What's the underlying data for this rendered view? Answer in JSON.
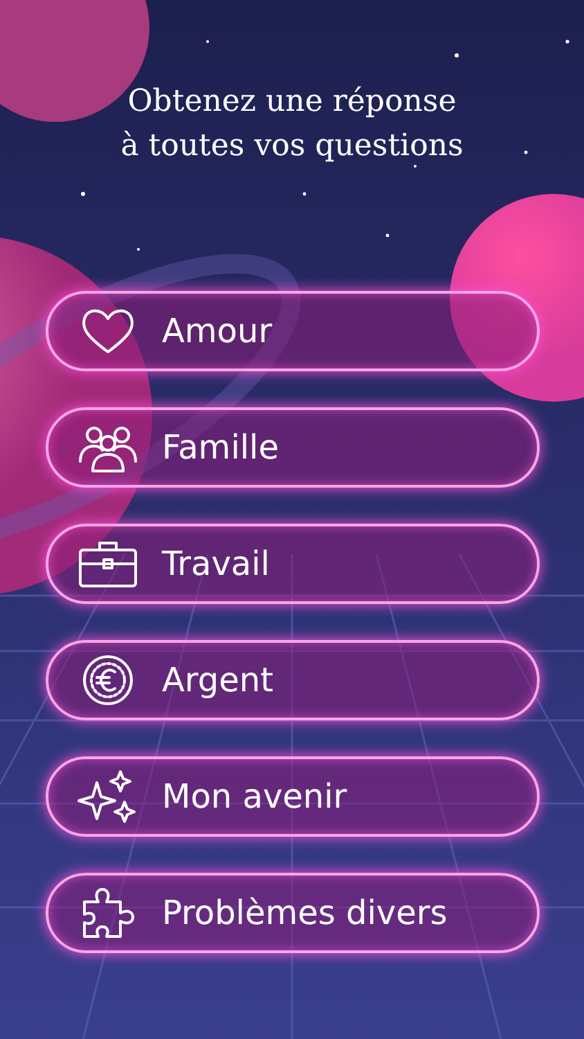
{
  "title": "Obtenez une réponse\nà toutes vos questions",
  "categories": [
    {
      "kind": "heart",
      "label": "Amour"
    },
    {
      "kind": "people",
      "label": "Famille"
    },
    {
      "kind": "briefcase",
      "label": "Travail"
    },
    {
      "kind": "coin",
      "label": "Argent"
    },
    {
      "kind": "sparkles",
      "label": "Mon avenir"
    },
    {
      "kind": "puzzle",
      "label": "Problèmes divers"
    }
  ]
}
